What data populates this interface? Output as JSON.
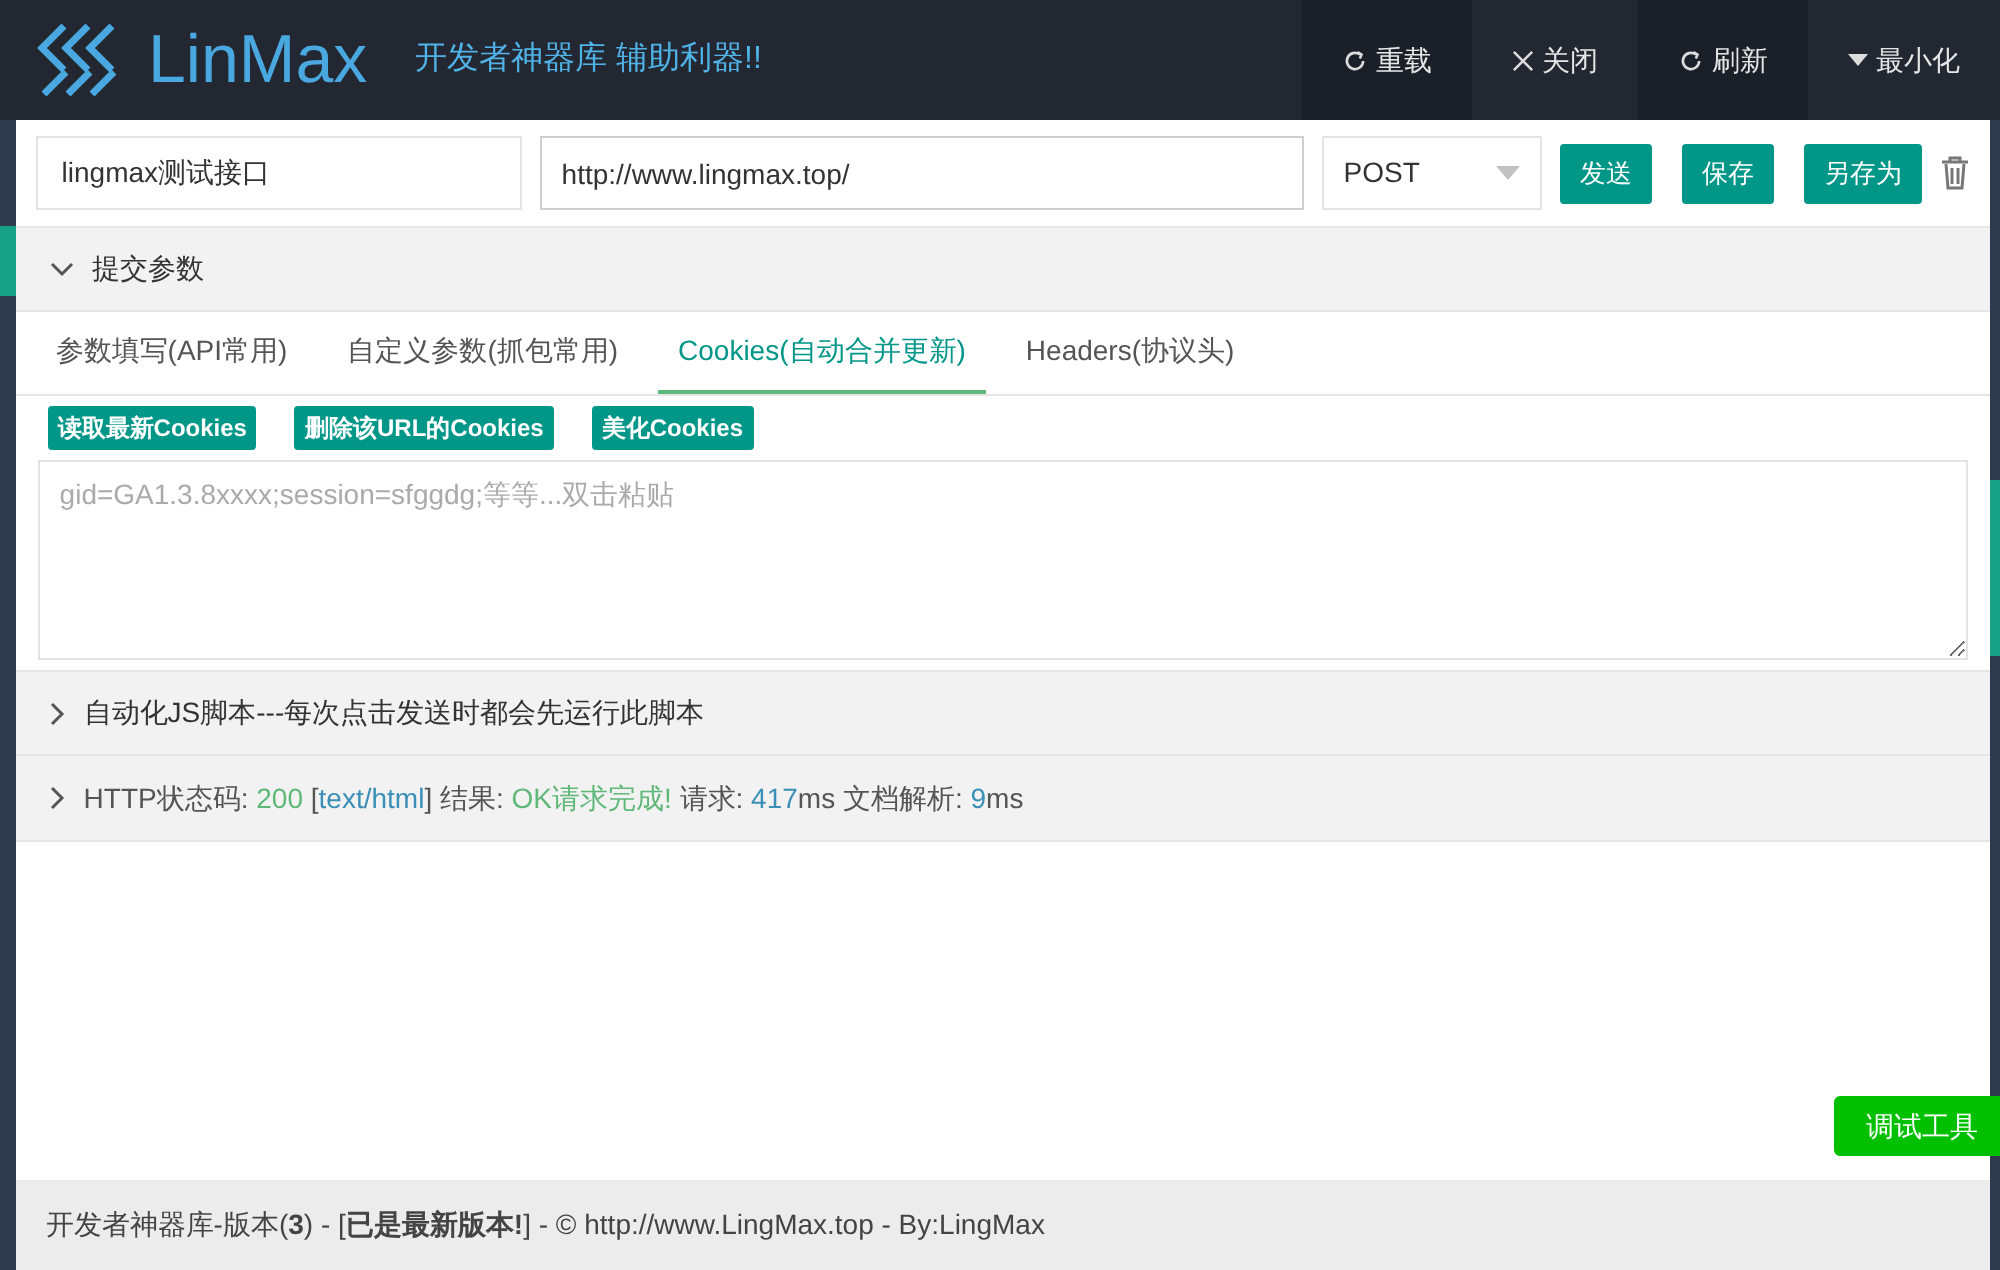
{
  "header": {
    "logo": "LinMax",
    "tagline": "开发者神器库 辅助利器!!",
    "actions": [
      {
        "kind": "reload",
        "label": "重载"
      },
      {
        "kind": "close",
        "label": "关闭"
      },
      {
        "kind": "refresh",
        "label": "刷新"
      },
      {
        "kind": "minimize",
        "label": "最小化"
      }
    ]
  },
  "request": {
    "name": "lingmax测试接口",
    "url": "http://www.lingmax.top/",
    "method": "POST",
    "buttons": [
      "发送",
      "保存",
      "另存为"
    ]
  },
  "sections": [
    {
      "title": "提交参数",
      "expanded": true
    },
    {
      "title": "自动化JS脚本---每次点击发送时都会先运行此脚本",
      "expanded": false
    }
  ],
  "tabs": [
    {
      "label": "参数填写(API常用)",
      "selected": false
    },
    {
      "label": "自定义参数(抓包常用)",
      "selected": false
    },
    {
      "label": "Cookies(自动合并更新)",
      "selected": true
    },
    {
      "label": "Headers(协议头)",
      "selected": false
    }
  ],
  "cookie_buttons": [
    "读取最新Cookies",
    "删除该URL的Cookies",
    "美化Cookies"
  ],
  "cookie_field": {
    "placeholder": "gid=GA1.3.8xxxx;session=sfggdg;等等...双击粘贴"
  },
  "status": {
    "expanded": false,
    "parts": [
      {
        "kind": "label",
        "text": "HTTP状态码: "
      },
      {
        "kind": "good",
        "text": "200"
      },
      {
        "kind": "label",
        "text": " ["
      },
      {
        "kind": "info",
        "text": "text/html"
      },
      {
        "kind": "label",
        "text": "] 结果: "
      },
      {
        "kind": "good",
        "text": "OK请求完成!"
      },
      {
        "kind": "label",
        "text": " 请求: "
      },
      {
        "kind": "info",
        "text": "417"
      },
      {
        "kind": "label",
        "text": "ms 文档解析: "
      },
      {
        "kind": "info",
        "text": "9"
      },
      {
        "kind": "label",
        "text": "ms"
      }
    ]
  },
  "debug_button": "调试工具",
  "footer": "开发者神器库-版本(**3**) - [**已是最新版本!**] - © http://www.LingMax.top - By:LingMax"
}
